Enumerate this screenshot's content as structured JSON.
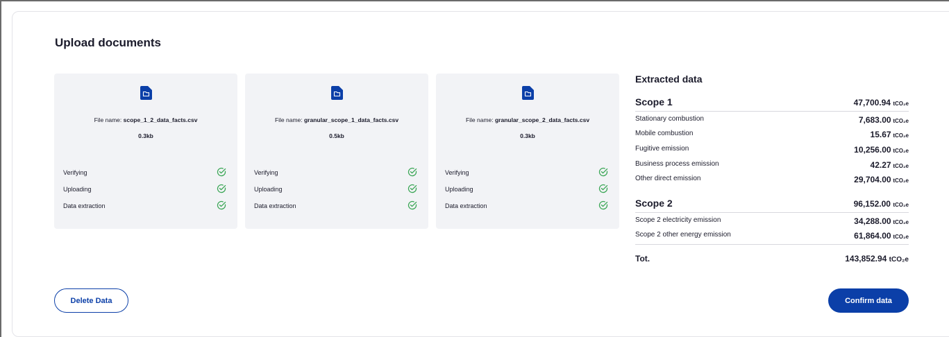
{
  "header": {
    "title": "Upload documents"
  },
  "files": [
    {
      "name_prefix": "File name: ",
      "name": "scope_1_2_data_facts.csv",
      "size": "0.3kb",
      "steps": [
        {
          "label": "Verifying"
        },
        {
          "label": "Uploading"
        },
        {
          "label": "Data extraction"
        }
      ]
    },
    {
      "name_prefix": "File name: ",
      "name": "granular_scope_1_data_facts.csv",
      "size": "0.5kb",
      "steps": [
        {
          "label": "Verifying"
        },
        {
          "label": "Uploading"
        },
        {
          "label": "Data extraction"
        }
      ]
    },
    {
      "name_prefix": "File name: ",
      "name": "granular_scope_2_data_facts.csv",
      "size": "0.3kb",
      "steps": [
        {
          "label": "Verifying"
        },
        {
          "label": "Uploading"
        },
        {
          "label": "Data extraction"
        }
      ]
    }
  ],
  "extracted": {
    "title": "Extracted data",
    "unit": "tCO₂e",
    "scope1": {
      "label": "Scope 1",
      "value": "47,700.94"
    },
    "scope1_rows": [
      {
        "label": "Stationary combustion",
        "value": "7,683.00"
      },
      {
        "label": "Mobile combustion",
        "value": "15.67"
      },
      {
        "label": "Fugitive emission",
        "value": "10,256.00"
      },
      {
        "label": "Business process emission",
        "value": "42.27"
      },
      {
        "label": "Other direct emission",
        "value": "29,704.00"
      }
    ],
    "scope2": {
      "label": "Scope 2",
      "value": "96,152.00"
    },
    "scope2_rows": [
      {
        "label": "Scope 2 electricity emission",
        "value": "34,288.00"
      },
      {
        "label": "Scope 2 other energy emission",
        "value": "61,864.00"
      }
    ],
    "total": {
      "label": "Tot.",
      "value": "143,852.94"
    }
  },
  "actions": {
    "delete_label": "Delete Data",
    "confirm_label": "Confirm data"
  },
  "colors": {
    "primary": "#0b3fa8",
    "card_bg": "#f2f3f6",
    "check": "#3aa655"
  },
  "icons": {
    "file": "file-folder-icon",
    "check": "check-circle-icon"
  }
}
